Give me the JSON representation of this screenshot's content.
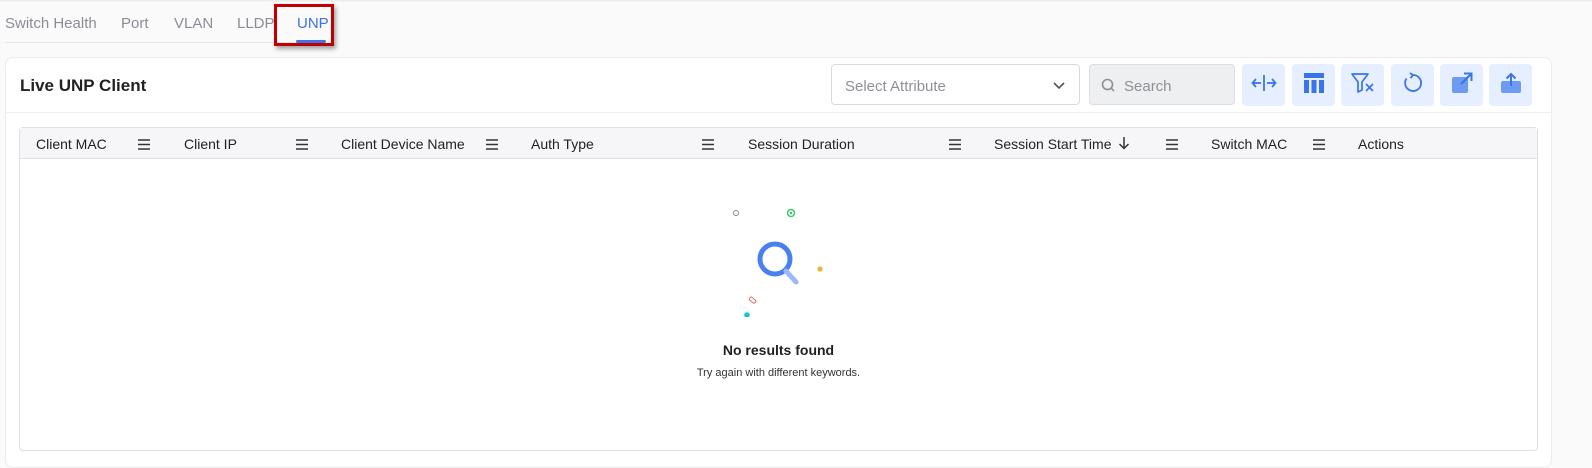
{
  "tabs": [
    {
      "label": "Switch Health"
    },
    {
      "label": "Port"
    },
    {
      "label": "VLAN"
    },
    {
      "label": "LLDP"
    },
    {
      "label": "UNP",
      "active": true
    }
  ],
  "card": {
    "title": "Live UNP Client"
  },
  "toolbar": {
    "select_placeholder": "Select Attribute",
    "search_placeholder": "Search",
    "buttons": [
      "resize-columns-icon",
      "column-layout-icon",
      "clear-filter-icon",
      "refresh-icon",
      "open-external-icon",
      "export-icon"
    ]
  },
  "table": {
    "columns": [
      {
        "label": "Client MAC"
      },
      {
        "label": "Client IP"
      },
      {
        "label": "Client Device Name"
      },
      {
        "label": "Auth Type"
      },
      {
        "label": "Session Duration"
      },
      {
        "label": "Session Start Time",
        "sorted": "descending"
      },
      {
        "label": "Switch MAC"
      },
      {
        "label": "Actions"
      }
    ],
    "rows": []
  },
  "empty_state": {
    "title": "No results found",
    "subtitle": "Try again with different keywords."
  },
  "colors": {
    "accent": "#3b73e8",
    "highlight": "#c00000",
    "tool_button_bg": "#e6efff"
  }
}
